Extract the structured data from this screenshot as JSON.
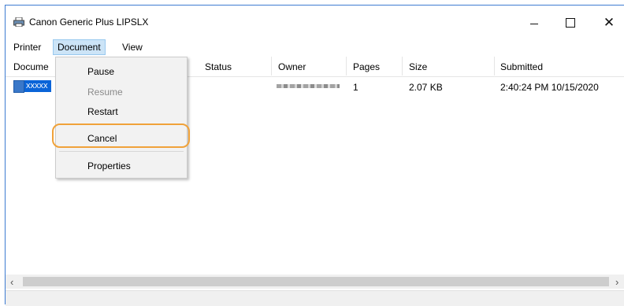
{
  "window": {
    "title": "Canon Generic Plus LIPSLX",
    "controls": {
      "minimize": "—",
      "maximize": "□",
      "close": "✕"
    }
  },
  "menubar": {
    "printer": "Printer",
    "document": "Document",
    "view": "View"
  },
  "columns": {
    "document": "Docume",
    "status": "Status",
    "owner": "Owner",
    "pages": "Pages",
    "size": "Size",
    "submitted": "Submitted"
  },
  "job": {
    "name": "xxxxx",
    "pages": "1",
    "size": "2.07 KB",
    "submitted": "2:40:24 PM 10/15/2020"
  },
  "document_menu": {
    "pause": "Pause",
    "resume": "Resume",
    "restart": "Restart",
    "cancel": "Cancel",
    "properties": "Properties"
  },
  "scroll": {
    "left": "‹",
    "right": "›"
  },
  "colors": {
    "highlight": "#f0a23a",
    "selection": "#0a64d8",
    "menu_hover": "#cce4f7"
  }
}
